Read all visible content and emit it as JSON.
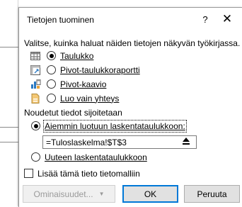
{
  "dialog": {
    "title": "Tietojen tuominen",
    "help_label": "?",
    "close_label": "✕",
    "instruction": "Valitse, kuinka haluat näiden tietojen näkyvän työkirjassa.",
    "view_options": [
      {
        "label": "Taulukko",
        "selected": true
      },
      {
        "label": "Pivot-taulukkoraportti",
        "selected": false
      },
      {
        "label": "Pivot-kaavio",
        "selected": false
      },
      {
        "label": "Luo vain yhteys",
        "selected": false
      }
    ],
    "placement_heading": "Noudetut tiedot sijoitetaan",
    "placement_options": [
      {
        "label": "Aiemmin luotuun laskentataulukkoon:",
        "selected": true
      },
      {
        "label": "Uuteen laskentataulukkoon",
        "selected": false
      }
    ],
    "range_value": "=Tuloslaskelma!$T$3",
    "data_model_checkbox": {
      "label": "Lisää tämä tieto tietomalliin",
      "checked": false
    },
    "buttons": {
      "properties": "Ominaisuudet...",
      "ok": "OK",
      "cancel": "Peruuta"
    }
  }
}
